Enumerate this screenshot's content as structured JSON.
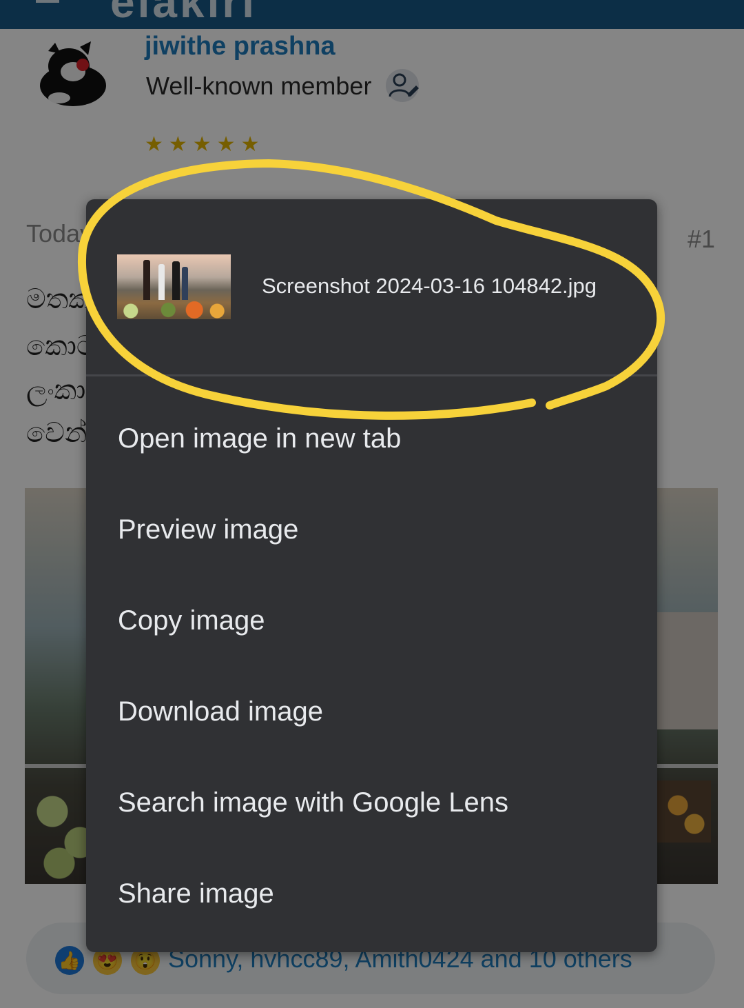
{
  "site": {
    "logo_text": "elakiri"
  },
  "post": {
    "username": "jiwithe prashna",
    "role": "Well-known member",
    "stars": "★★★★★",
    "date": "Today",
    "post_number": "#1",
    "body_lines": [
      "මතක",
      "කොට",
      "ලංකා",
      "වෙන්"
    ],
    "reaction_names": "Sonny, hvhcc89, Amith0424 and 10 others"
  },
  "context_menu": {
    "filename": "Screenshot 2024-03-16 104842.jpg",
    "items": [
      "Open image in new tab",
      "Preview image",
      "Copy image",
      "Download image",
      "Search image with Google Lens",
      "Share image"
    ]
  },
  "colors": {
    "header_bg": "#185886",
    "link_blue": "#1d7bbd",
    "menu_bg": "#303134",
    "menu_text": "#e8eaed",
    "annotation": "#f7d23a"
  }
}
